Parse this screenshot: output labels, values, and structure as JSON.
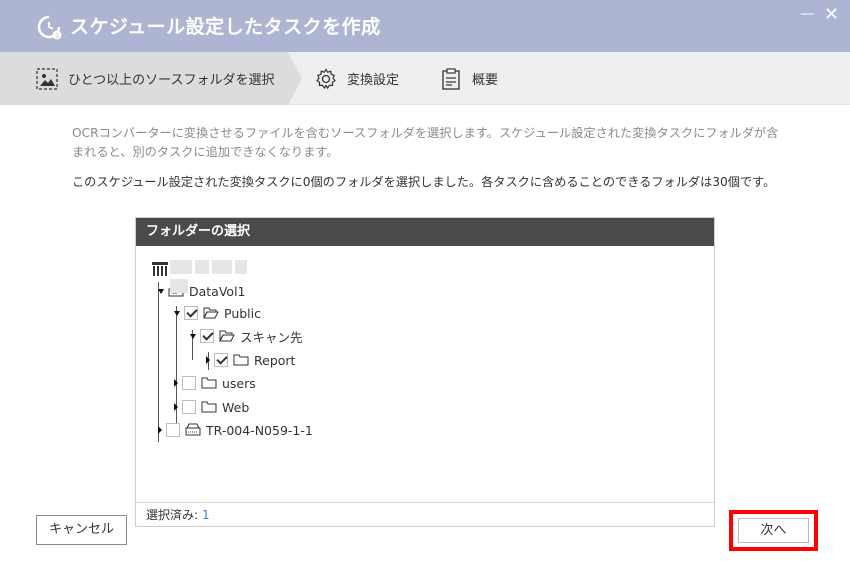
{
  "window": {
    "title": "スケジュール設定したタスクを作成",
    "minimize_glyph": "—",
    "close_glyph": "✕"
  },
  "steps": [
    {
      "label": "ひとつ以上のソースフォルダを選択",
      "icon": "image-select-icon",
      "active": true
    },
    {
      "label": "変換設定",
      "icon": "gear-icon",
      "active": false
    },
    {
      "label": "概要",
      "icon": "clipboard-icon",
      "active": false
    }
  ],
  "description": {
    "line1": "OCRコンバーターに変換させるファイルを含むソースフォルダを選択します。スケジュール設定された変換タスクにフォルダが含まれると、別のタスクに追加できなくなります。",
    "line2": "このスケジュール設定された変換タスクに0個のフォルダを選択しました。各タスクに含めることのできるフォルダは30個です。"
  },
  "panel": {
    "header": "フォルダーの選択",
    "selected_label": "選択済み:",
    "selected_count": "1"
  },
  "tree": {
    "root_label": "",
    "volume1": "DataVol1",
    "public": "Public",
    "scan": "スキャン先",
    "report": "Report",
    "users": "users",
    "web": "Web",
    "volume2": "TR-004-N059-1-1"
  },
  "buttons": {
    "cancel": "キャンセル",
    "next": "次へ"
  },
  "colors": {
    "titlebar": "#aeb5d3",
    "highlight": "#ff0000",
    "count_link": "#3a86d1"
  }
}
